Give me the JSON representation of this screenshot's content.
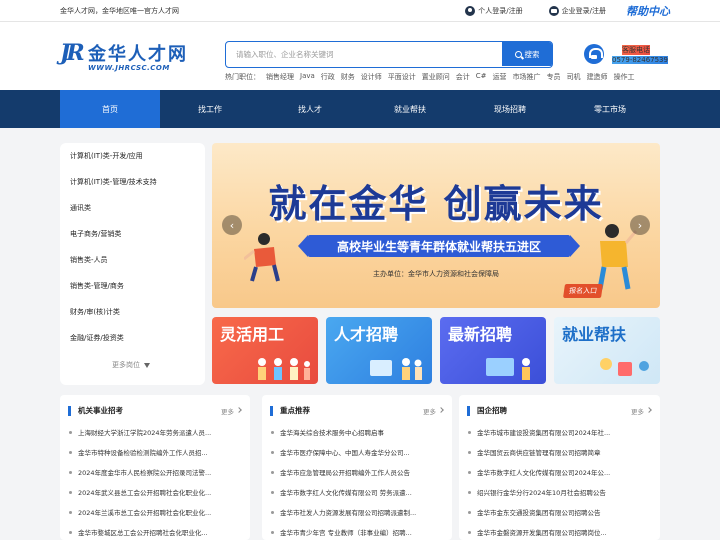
{
  "topbar": {
    "slogan": "金华人才网，金华地区唯一官方人才网",
    "personal_login": "个人登录/注册",
    "company_login": "企业登录/注册",
    "help_center": "帮助中心"
  },
  "header": {
    "logo_mark": "JR",
    "logo_name": "金华人才网",
    "logo_domain": "WWW.JHRCSC.COM",
    "search_placeholder": "请输入职位、企业名称关键词",
    "search_button": "搜索",
    "hotwords_label": "热门职位：",
    "hotwords": [
      "销售经理",
      "Java",
      "行政",
      "财务",
      "设计师",
      "平面设计",
      "置业顾问",
      "会计",
      "C#",
      "运营",
      "市场推广",
      "专员",
      "司机",
      "建造师",
      "操作工"
    ],
    "service_label": "客服电话",
    "service_phone": "0579-82467539"
  },
  "nav": {
    "items": [
      "首页",
      "找工作",
      "找人才",
      "就业帮扶",
      "现场招聘",
      "零工市场"
    ],
    "active_index": 0
  },
  "sidebar": {
    "categories": [
      "计算机(IT)类-开发/应用",
      "计算机(IT)类-管理/技术支持",
      "通讯类",
      "电子商务/营销类",
      "销售类-人员",
      "销售类-管理/商务",
      "财务/审(核)计类",
      "金融/证券/投资类"
    ],
    "more": "更多岗位"
  },
  "banner": {
    "title": "就在金华  创赢未来",
    "ribbon": "高校毕业生等青年群体就业帮扶五进区",
    "organizer": "主办单位：金华市人力资源和社会保障局",
    "signup": "报名入口",
    "prev_glyph": "‹",
    "next_glyph": "›"
  },
  "tiles": [
    "灵活用工",
    "人才招聘",
    "最新招聘",
    "就业帮扶"
  ],
  "panels": [
    {
      "title": "机关事业招考",
      "more": "更多",
      "items": [
        "上海财经大学浙江学院2024年劳务派遣人员...",
        "金华市特种设备检验检测院编外工作人员招...",
        "2024年度金华市人民检察院公开招录司法警...",
        "2024年武义县总工会公开招聘社会化职业化...",
        "2024年兰溪市总工会公开招聘社会化职业化...",
        "金华市婺城区总工会公开招聘社会化职业化..."
      ]
    },
    {
      "title": "重点推荐",
      "more": "更多",
      "items": [
        "金华海关综合技术服务中心招聘启事",
        "金华市医疗保障中心、中国人寿金华分公司...",
        "金华市应急管理局公开招聘编外工作人员公告",
        "金华市数字红人文化传媒有限公司 劳务派遣...",
        "金华市社发人力资源发展有限公司招聘派遣制...",
        "金华市青少年宫 专业教师（非事业编）招聘..."
      ]
    },
    {
      "title": "国企招聘",
      "more": "更多",
      "items": [
        "金华市城市建设投资集团有限公司2024年社...",
        "金华国贸云商供应链管理有限公司招聘简章",
        "金华市数字红人文化传媒有限公司2024年公...",
        "绍兴银行金华分行2024年10月社会招聘公告",
        "金华市金东交通投资集团有限公司招聘公告",
        "金华市金磐资源开发集团有限公司招聘岗位..."
      ]
    }
  ],
  "colors": {
    "brand_blue": "#1f6dd6",
    "nav_dark": "#143b6c",
    "banner_title": "#1d3a96"
  }
}
